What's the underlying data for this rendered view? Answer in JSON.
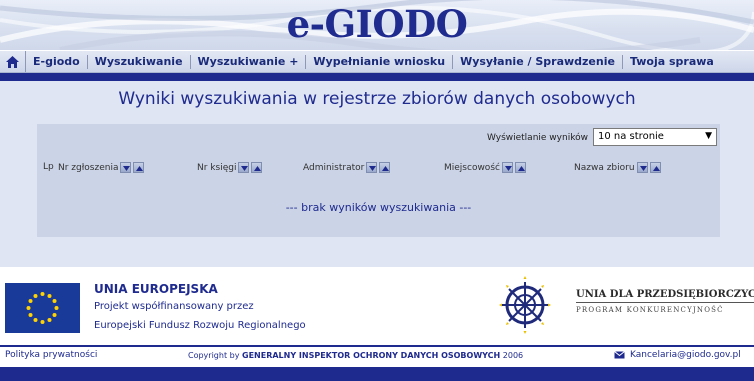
{
  "header": {
    "logo": "e-GIODO"
  },
  "nav": {
    "home_icon": "home-icon",
    "items": [
      "E-giodo",
      "Wyszukiwanie",
      "Wyszukiwanie +",
      "Wypełnianie wniosku",
      "Wysyłanie / Sprawdzenie",
      "Twoja sprawa"
    ]
  },
  "main": {
    "title": "Wyniki wyszukiwania w rejestrze zbiorów danych osobowych",
    "display_label": "Wyświetlanie wyników",
    "display_value": "10 na stronie",
    "columns": {
      "lp": "Lp",
      "nr_zgloszenia": "Nr zgłoszenia",
      "nr_ksiegi": "Nr księgi",
      "administrator": "Administrator",
      "miejscowosc": "Miejscowość",
      "nazwa_zbioru": "Nazwa zbioru"
    },
    "no_results": "--- brak wyników wyszukiwania ---"
  },
  "footer": {
    "eu_title": "UNIA EUROPEJSKA",
    "eu_line1": "Projekt współfinansowany przez",
    "eu_line2": "Europejski Fundusz Rozwoju Regionalnego",
    "ud_title": "UNIA DLA PRZEDSIĘBIORCZYCH",
    "ud_sub": "PROGRAM KONKURENCYJNOŚĆ",
    "privacy": "Polityka prywatności",
    "copyright_prefix": "Copyright by",
    "copyright_org": "GENERALNY INSPEKTOR OCHRONY DANYCH OSOBOWYCH",
    "copyright_year": "2006",
    "email": "Kancelaria@giodo.gov.pl"
  },
  "colors": {
    "brand_blue": "#1f2a8e",
    "panel": "#dfe5f2",
    "results_bg": "#cbd3e6"
  }
}
